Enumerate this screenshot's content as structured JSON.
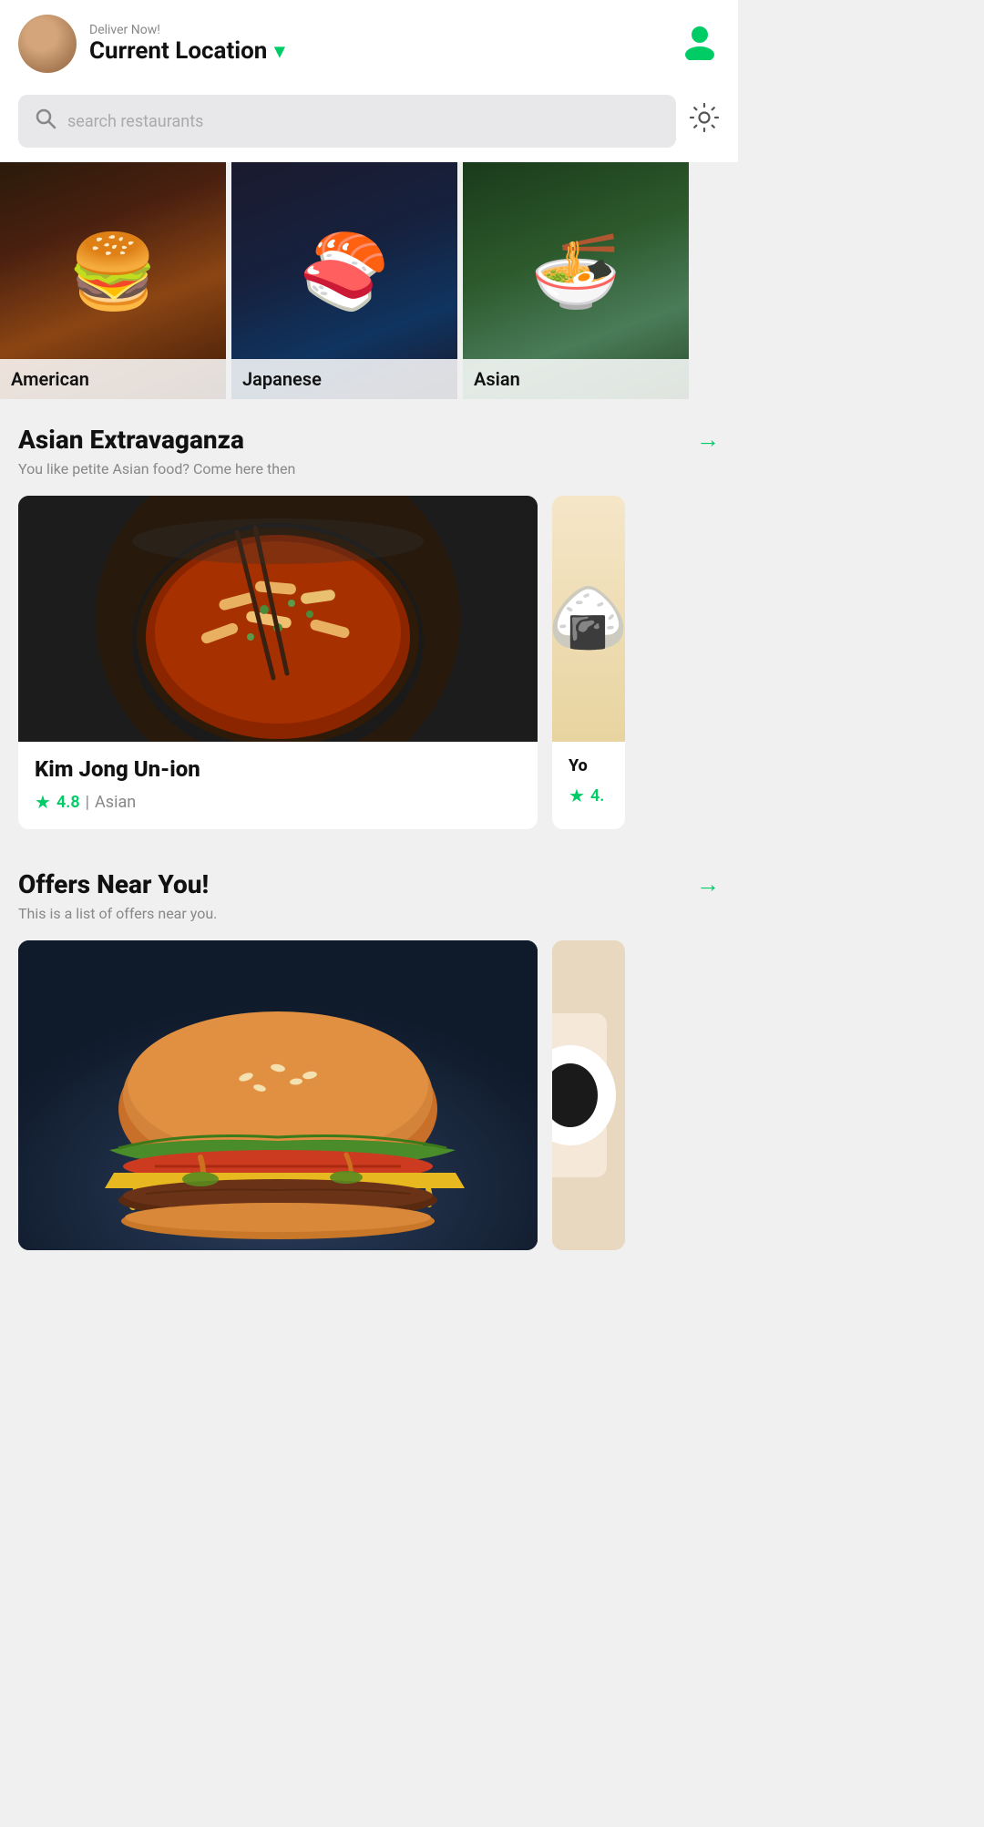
{
  "header": {
    "deliver_now": "Deliver Now!",
    "location": "Current Location",
    "chevron": "▾"
  },
  "search": {
    "placeholder": "search restaurants"
  },
  "categories": [
    {
      "id": "american",
      "label": "American"
    },
    {
      "id": "japanese",
      "label": "Japanese"
    },
    {
      "id": "asian",
      "label": "Asian"
    }
  ],
  "sections": [
    {
      "id": "asian-extravaganza",
      "title": "Asian Extravaganza",
      "subtitle": "You like petite Asian food? Come here then",
      "arrow": "→",
      "restaurants": [
        {
          "id": "kimjong",
          "name": "Kim Jong Un-ion",
          "rating": "4.8",
          "cuisine": "Asian"
        },
        {
          "id": "partial2",
          "name": "Yo",
          "rating": "4.",
          "cuisine": ""
        }
      ]
    },
    {
      "id": "offers-near-you",
      "title": "Offers Near You!",
      "subtitle": "This is a list of offers near you.",
      "arrow": "→",
      "restaurants": [
        {
          "id": "burger",
          "name": "",
          "rating": "",
          "cuisine": ""
        }
      ]
    }
  ],
  "icons": {
    "search": "🔍",
    "gear": "⚙",
    "star": "★",
    "arrow_right": "→",
    "chevron_down": "▾",
    "user": "👤"
  },
  "colors": {
    "green": "#00cc66",
    "dark": "#111111",
    "gray": "#888888",
    "light_gray": "#f0f0f0",
    "search_bg": "#e8e8eb"
  }
}
